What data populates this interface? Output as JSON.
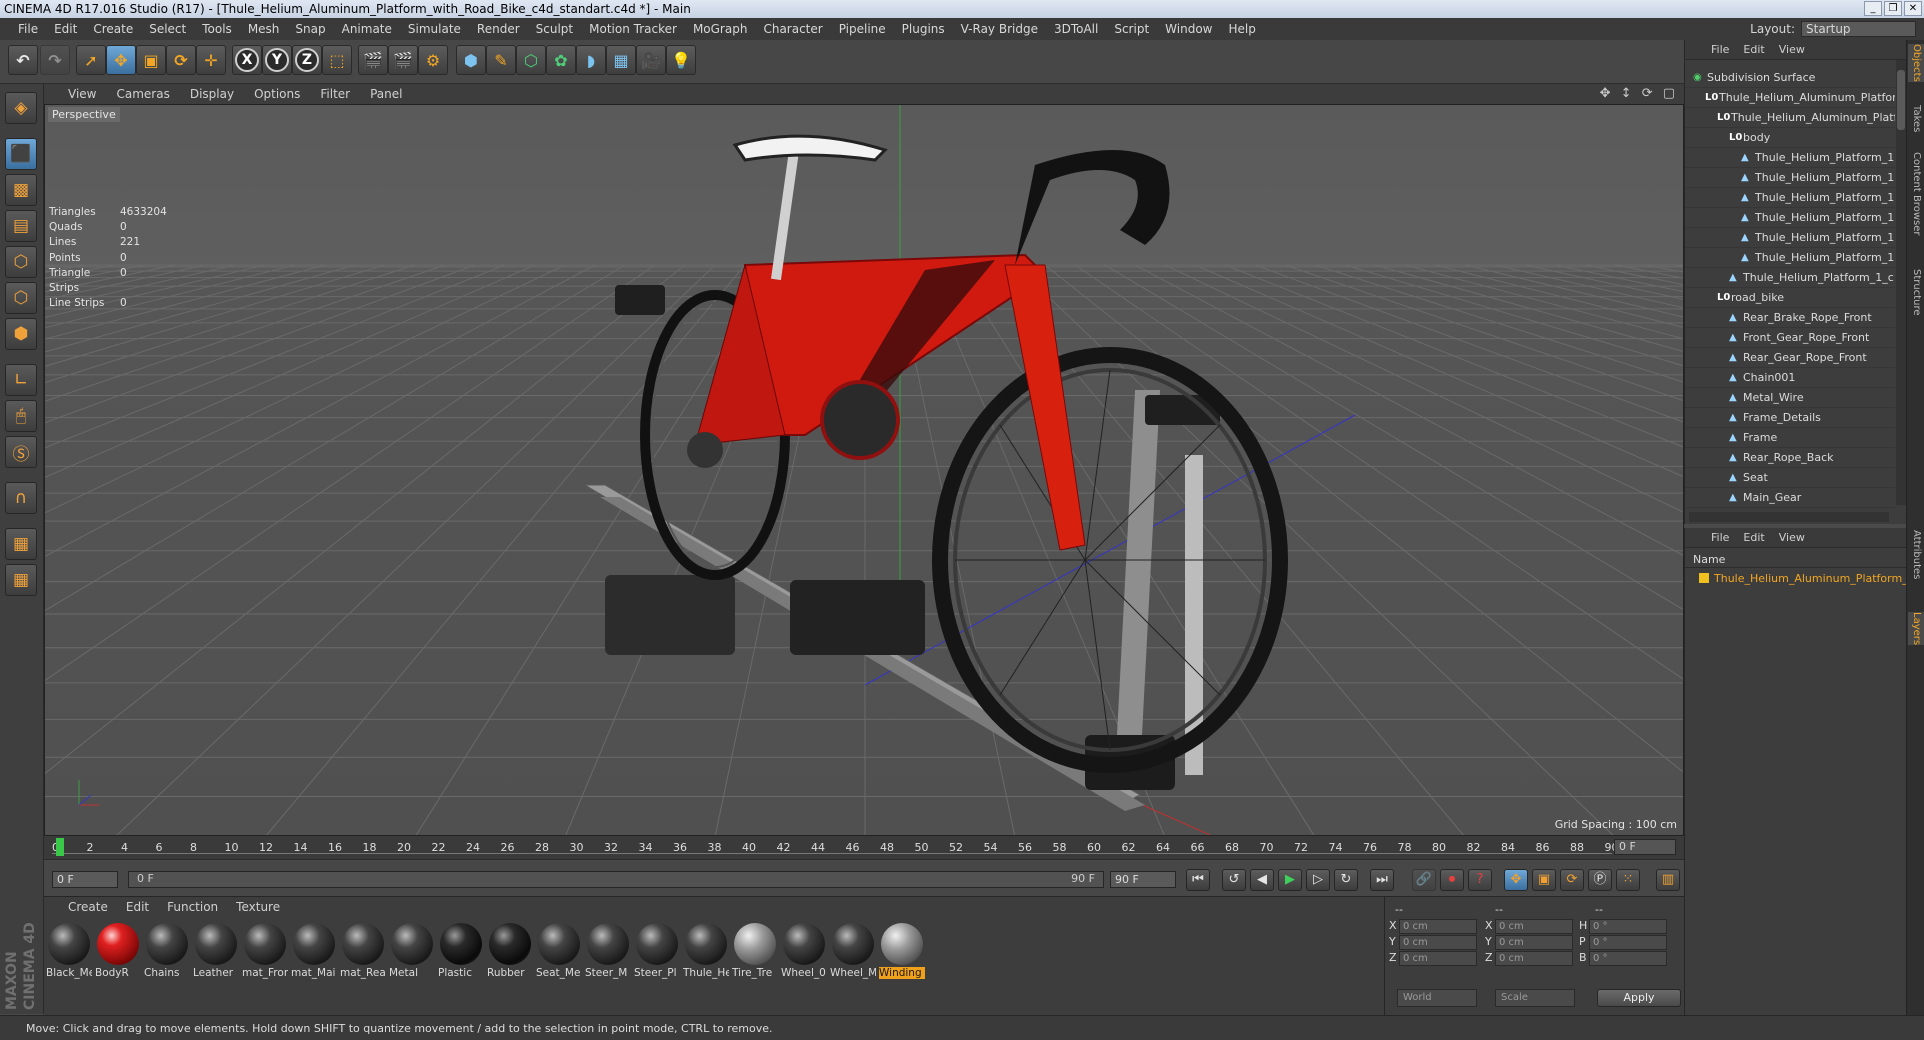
{
  "window": {
    "title": "CINEMA 4D R17.016 Studio (R17) - [Thule_Helium_Aluminum_Platform_with_Road_Bike_c4d_standart.c4d *] - Main",
    "controls": [
      "_",
      "❐",
      "✕"
    ]
  },
  "menubar": {
    "items": [
      "File",
      "Edit",
      "Create",
      "Select",
      "Tools",
      "Mesh",
      "Snap",
      "Animate",
      "Simulate",
      "Render",
      "Sculpt",
      "Motion Tracker",
      "MoGraph",
      "Character",
      "Pipeline",
      "Plugins",
      "V-Ray Bridge",
      "3DToAll",
      "Script",
      "Window",
      "Help"
    ],
    "layout_label": "Layout:",
    "layout_value": "Startup"
  },
  "toolbar": {
    "axis_x": "X",
    "axis_y": "Y",
    "axis_z": "Z"
  },
  "viewport": {
    "menu": [
      "View",
      "Cameras",
      "Display",
      "Options",
      "Filter",
      "Panel"
    ],
    "camera_label": "Perspective",
    "nav_icons": "✥ ↕ ⟳ ▢",
    "stats": [
      {
        "label": "Triangles",
        "value": "4633204"
      },
      {
        "label": "Quads",
        "value": "0"
      },
      {
        "label": "Lines",
        "value": "221"
      },
      {
        "label": "Points",
        "value": "0"
      },
      {
        "label": "Triangle Strips",
        "value": "0"
      },
      {
        "label": "Line Strips",
        "value": "0"
      }
    ],
    "grid_spacing": "Grid Spacing : 100 cm",
    "colors": {
      "frame_red": "#d01a10",
      "rack_grey": "#8c8c8c",
      "accent_orange": "#f2a623"
    }
  },
  "timeline": {
    "ticks": [
      "0",
      "2",
      "4",
      "6",
      "8",
      "10",
      "12",
      "14",
      "16",
      "18",
      "20",
      "22",
      "24",
      "26",
      "28",
      "30",
      "32",
      "34",
      "36",
      "38",
      "40",
      "42",
      "44",
      "46",
      "48",
      "50",
      "52",
      "54",
      "56",
      "58",
      "60",
      "62",
      "64",
      "66",
      "68",
      "70",
      "72",
      "74",
      "76",
      "78",
      "80",
      "82",
      "84",
      "86",
      "88",
      "90"
    ],
    "current_frame": "0 F"
  },
  "transport": {
    "start_field": "0 F",
    "range_start": "0 F",
    "range_end": "90 F",
    "end_field": "90 F"
  },
  "materials": {
    "menu": [
      "Create",
      "Edit",
      "Function",
      "Texture"
    ],
    "items": [
      {
        "label": "Black_Me",
        "kind": "dark"
      },
      {
        "label": "BodyR",
        "kind": "red"
      },
      {
        "label": "Chains",
        "kind": "dark"
      },
      {
        "label": "Leather",
        "kind": "dark"
      },
      {
        "label": "mat_Fron",
        "kind": "dark"
      },
      {
        "label": "mat_Mai",
        "kind": "dark"
      },
      {
        "label": "mat_Rea",
        "kind": "dark"
      },
      {
        "label": "Metal",
        "kind": "dark"
      },
      {
        "label": "Plastic",
        "kind": "black"
      },
      {
        "label": "Rubber",
        "kind": "black"
      },
      {
        "label": "Seat_Me",
        "kind": "dark"
      },
      {
        "label": "Steer_M",
        "kind": "dark"
      },
      {
        "label": "Steer_Pl",
        "kind": "dark"
      },
      {
        "label": "Thule_He",
        "kind": "dark"
      },
      {
        "label": "Tire_Tre",
        "kind": "grey"
      },
      {
        "label": "Wheel_0",
        "kind": "dark"
      },
      {
        "label": "Wheel_M",
        "kind": "dark"
      },
      {
        "label": "Winding",
        "kind": "grey",
        "selected": true
      }
    ]
  },
  "coordinates": {
    "header": [
      "--",
      "--",
      "--"
    ],
    "rows": [
      {
        "a": "X",
        "av": "0 cm",
        "b": "X",
        "bv": "0 cm",
        "c": "H",
        "cv": "0 °"
      },
      {
        "a": "Y",
        "av": "0 cm",
        "b": "Y",
        "bv": "0 cm",
        "c": "P",
        "cv": "0 °"
      },
      {
        "a": "Z",
        "av": "0 cm",
        "b": "Z",
        "bv": "0 cm",
        "c": "B",
        "cv": "0 °"
      }
    ],
    "world": "World",
    "scale": "Scale",
    "apply": "Apply"
  },
  "objects": {
    "menu": [
      "File",
      "Edit",
      "View"
    ],
    "tree": [
      {
        "name": "Subdivision Surface",
        "indent": 0,
        "icon": "green"
      },
      {
        "name": "Thule_Helium_Aluminum_Platform",
        "indent": 1,
        "icon": "null"
      },
      {
        "name": "Thule_Helium_Aluminum_Platform",
        "indent": 2,
        "icon": "null"
      },
      {
        "name": "body",
        "indent": 3,
        "icon": "null"
      },
      {
        "name": "Thule_Helium_Platform_1",
        "indent": 4,
        "icon": "poly"
      },
      {
        "name": "Thule_Helium_Platform_1",
        "indent": 4,
        "icon": "poly"
      },
      {
        "name": "Thule_Helium_Platform_1",
        "indent": 4,
        "icon": "poly"
      },
      {
        "name": "Thule_Helium_Platform_1",
        "indent": 4,
        "icon": "poly"
      },
      {
        "name": "Thule_Helium_Platform_1",
        "indent": 4,
        "icon": "poly"
      },
      {
        "name": "Thule_Helium_Platform_1",
        "indent": 4,
        "icon": "poly"
      },
      {
        "name": "Thule_Helium_Platform_1_c",
        "indent": 3,
        "icon": "poly"
      },
      {
        "name": "road_bike",
        "indent": 2,
        "icon": "null"
      },
      {
        "name": "Rear_Brake_Rope_Front",
        "indent": 3,
        "icon": "poly"
      },
      {
        "name": "Front_Gear_Rope_Front",
        "indent": 3,
        "icon": "poly"
      },
      {
        "name": "Rear_Gear_Rope_Front",
        "indent": 3,
        "icon": "poly"
      },
      {
        "name": "Chain001",
        "indent": 3,
        "icon": "poly"
      },
      {
        "name": "Metal_Wire",
        "indent": 3,
        "icon": "poly"
      },
      {
        "name": "Frame_Details",
        "indent": 3,
        "icon": "poly"
      },
      {
        "name": "Frame",
        "indent": 3,
        "icon": "poly"
      },
      {
        "name": "Rear_Rope_Back",
        "indent": 3,
        "icon": "poly"
      },
      {
        "name": "Seat",
        "indent": 3,
        "icon": "poly"
      },
      {
        "name": "Main_Gear",
        "indent": 3,
        "icon": "poly"
      }
    ]
  },
  "layers": {
    "menu": [
      "File",
      "Edit",
      "View"
    ],
    "header": "Name",
    "row": "Thule_Helium_Aluminum_Platform_w"
  },
  "side_tabs": {
    "top": [
      "Objects",
      "Takes",
      "Content Browser",
      "Structure"
    ],
    "bottom": [
      "Attributes",
      "Layers"
    ]
  },
  "status": "Move: Click and drag to move elements. Hold down SHIFT to quantize movement / add to the selection in point mode, CTRL to remove.",
  "brand": "MAXON CINEMA 4D"
}
